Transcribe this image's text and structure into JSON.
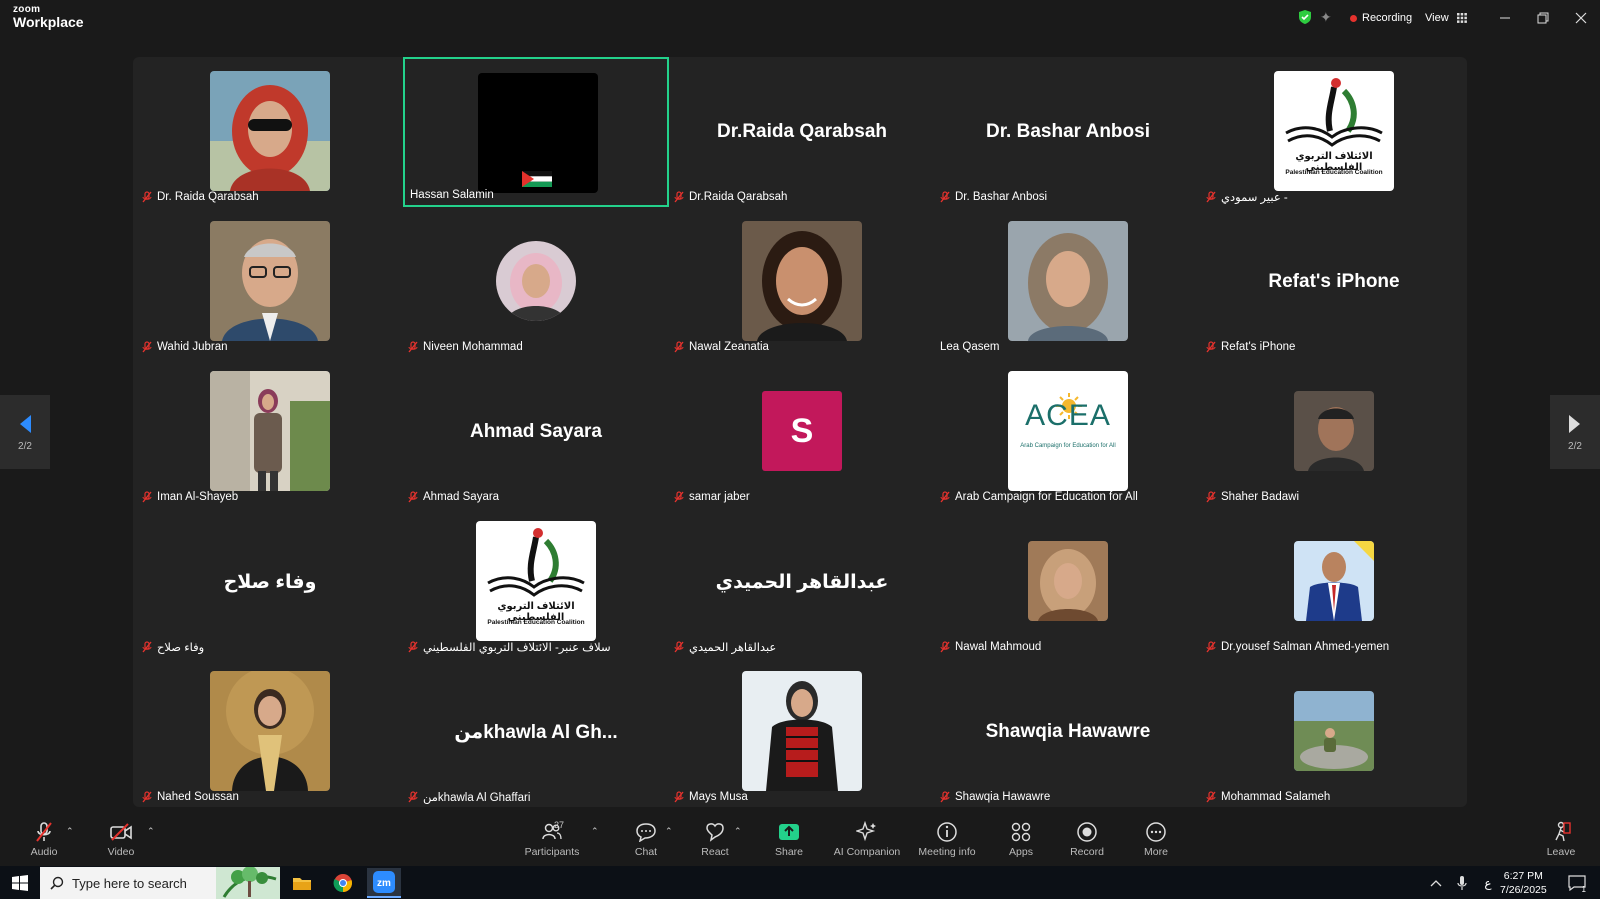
{
  "app": {
    "logo_top": "zoom",
    "logo_bottom": "Workplace"
  },
  "titlebar": {
    "recording": "Recording",
    "view": "View"
  },
  "pager": {
    "left_page": "2/2",
    "right_page": "2/2"
  },
  "tiles": [
    {
      "display": "photo",
      "name": "Dr. Raida Qarabsah",
      "muted": true,
      "photo": "woman-red-hijab"
    },
    {
      "display": "black",
      "name": "Hassan Salamin",
      "muted": false,
      "active": true
    },
    {
      "display": "text",
      "big_name": "Dr.Raida Qarabsah",
      "name": "Dr.Raida Qarabsah",
      "muted": true
    },
    {
      "display": "text",
      "big_name": "Dr. Bashar Anbosi",
      "name": "Dr. Bashar Anbosi",
      "muted": true
    },
    {
      "display": "logo-pec",
      "name": "عبير سمودي -",
      "muted": true,
      "logo_ar": "الائتلاف التربوي الفلسطيني",
      "logo_en": "Palestinian Education Coalition"
    },
    {
      "display": "photo",
      "name": "Wahid Jubran",
      "muted": true,
      "photo": "man-glasses"
    },
    {
      "display": "photo-round",
      "name": "Niveen Mohammad",
      "muted": true,
      "photo": "woman-pink-hijab"
    },
    {
      "display": "photo",
      "name": "Nawal Zeanatia",
      "muted": true,
      "photo": "woman-dark-hair"
    },
    {
      "display": "photo",
      "name": "Lea Qasem",
      "muted": false,
      "photo": "woman-patterned-hijab"
    },
    {
      "display": "text",
      "big_name": "Refat's iPhone",
      "name": "Refat's iPhone",
      "muted": true
    },
    {
      "display": "photo",
      "name": "Iman Al-Shayeb",
      "muted": true,
      "photo": "woman-standing"
    },
    {
      "display": "text",
      "big_name": "Ahmad Sayara",
      "name": "Ahmad Sayara",
      "muted": true
    },
    {
      "display": "letter",
      "letter": "S",
      "name": "samar jaber",
      "muted": true
    },
    {
      "display": "logo-acea",
      "name": "Arab Campaign for Education for All",
      "muted": true,
      "logo_text": "ACEA",
      "logo_sub": "Arab Campaign for Education for All"
    },
    {
      "display": "photo-sm",
      "name": "Shaher Badawi",
      "muted": true,
      "photo": "man-portrait"
    },
    {
      "display": "text",
      "big_name": "وفاء صلاح",
      "name": "وفاء صلاح",
      "muted": true
    },
    {
      "display": "logo-pec",
      "name": "سلاف عنبر- الائتلاف التربوي الفلسطيني",
      "muted": true,
      "logo_ar": "الائتلاف التربوي الفلسطيني",
      "logo_en": "Palestinian Education Coalition"
    },
    {
      "display": "text",
      "big_name": "عبدالقاهر الحميدي",
      "name": "عبدالقاهر الحميدي",
      "muted": true
    },
    {
      "display": "photo-sm",
      "name": "Nawal Mahmoud",
      "muted": true,
      "photo": "woman-beige-hijab"
    },
    {
      "display": "photo-sm",
      "name": "Dr.yousef Salman Ahmed-yemen",
      "muted": true,
      "photo": "man-suit"
    },
    {
      "display": "photo",
      "name": "Nahed Soussan",
      "muted": true,
      "photo": "woman-scarf"
    },
    {
      "display": "text",
      "big_name": "منkhawla  Al Gh...",
      "name": "منkhawla  Al Ghaffari",
      "muted": true
    },
    {
      "display": "photo",
      "name": "Mays Musa",
      "muted": true,
      "photo": "woman-embroidered"
    },
    {
      "display": "text",
      "big_name": "Shawqia Hawawre",
      "name": "Shawqia Hawawre",
      "muted": true
    },
    {
      "display": "photo-sm",
      "name": "Mohammad Salameh",
      "muted": true,
      "photo": "man-outdoors"
    }
  ],
  "toolbar": {
    "audio": "Audio",
    "video": "Video",
    "participants": "Participants",
    "participant_count": "27",
    "chat": "Chat",
    "react": "React",
    "share": "Share",
    "ai_companion": "AI Companion",
    "meeting_info": "Meeting info",
    "apps": "Apps",
    "record": "Record",
    "more": "More",
    "leave": "Leave"
  },
  "taskbar": {
    "search_placeholder": "Type here to search",
    "time": "6:27 PM",
    "date": "7/26/2025",
    "lang": "ع",
    "notif_count": "1"
  },
  "colors": {
    "active_border": "#23d18b",
    "share_green": "#23d18b",
    "muted_red": "#e5322d",
    "avatar_magenta": "#c2185b"
  }
}
